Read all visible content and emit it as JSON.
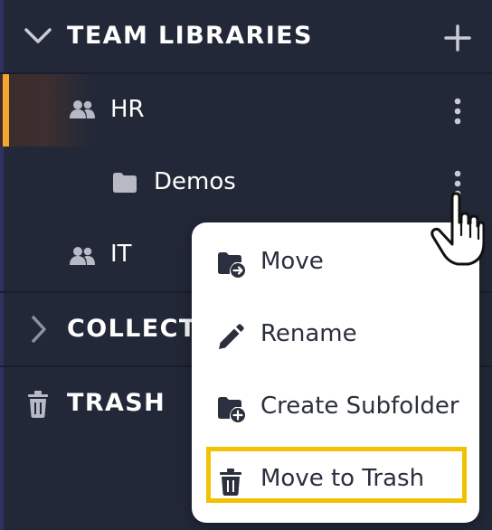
{
  "sidebar": {
    "team_libraries": {
      "title": "TEAM LIBRARIES"
    },
    "hr": {
      "label": "HR"
    },
    "demos": {
      "label": "Demos"
    },
    "it": {
      "label": "IT"
    },
    "collections": {
      "title": "COLLECTI"
    },
    "trash": {
      "title": "TRASH"
    }
  },
  "context_menu": {
    "items": [
      {
        "label": "Move",
        "icon": "folder-move-icon"
      },
      {
        "label": "Rename",
        "icon": "pencil-icon"
      },
      {
        "label": "Create Subfolder",
        "icon": "folder-plus-icon"
      },
      {
        "label": "Move to Trash",
        "icon": "trash-icon"
      }
    ]
  },
  "colors": {
    "background": "#232838",
    "accent": "#f7a531",
    "highlight_box": "#f2c200",
    "menu_text": "#2b2f3e"
  }
}
